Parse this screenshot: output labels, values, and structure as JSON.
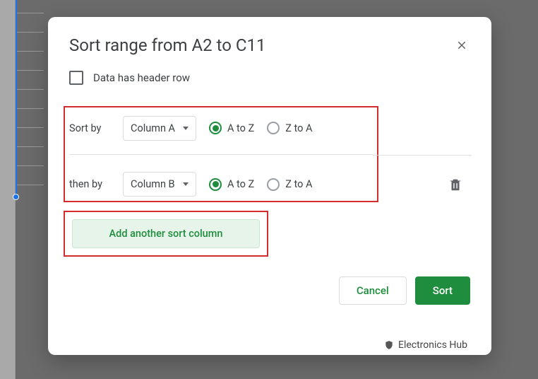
{
  "dialog": {
    "title": "Sort range from A2 to C11",
    "header_row_label": "Data has header row",
    "sort_rules": [
      {
        "label": "Sort by",
        "column": "Column A",
        "opt_az": "A to Z",
        "opt_za": "Z to A",
        "direction": "az",
        "deletable": false
      },
      {
        "label": "then by",
        "column": "Column B",
        "opt_az": "A to Z",
        "opt_za": "Z to A",
        "direction": "az",
        "deletable": true
      }
    ],
    "add_button": "Add another sort column",
    "cancel": "Cancel",
    "sort": "Sort"
  },
  "watermark": "Electronics Hub"
}
